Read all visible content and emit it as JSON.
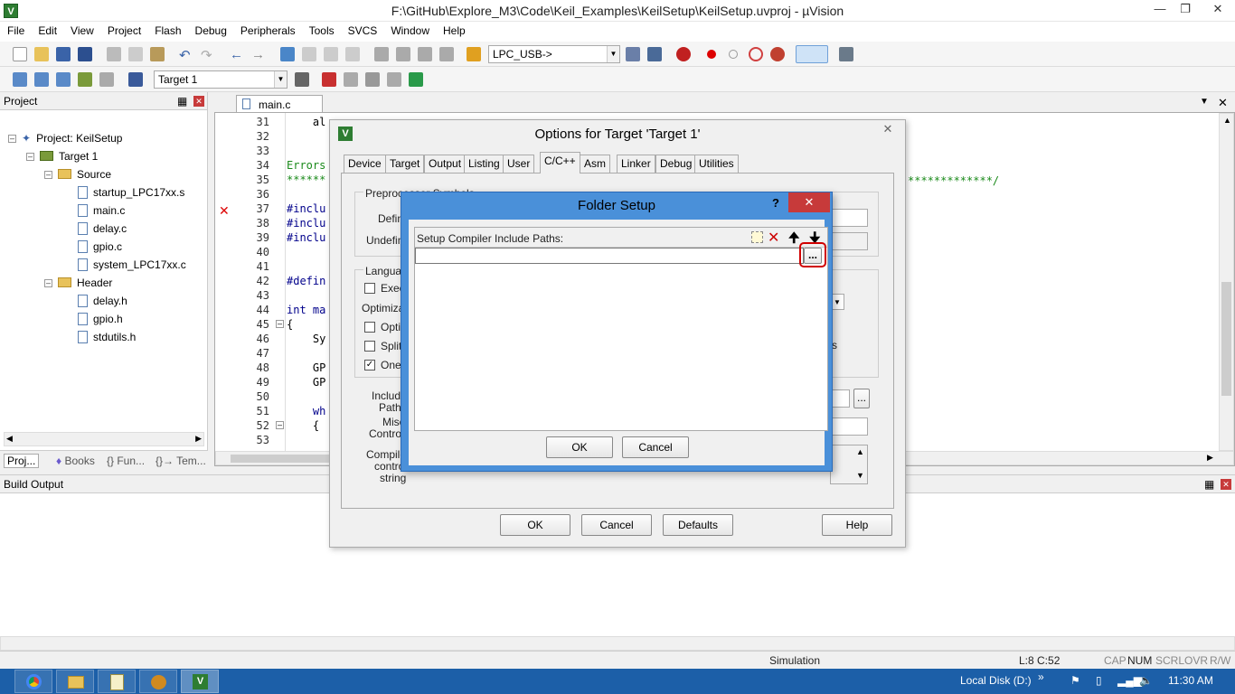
{
  "window": {
    "title": "F:\\GitHub\\Explore_M3\\Code\\Keil_Examples\\KeilSetup\\KeilSetup.uvproj - µVision"
  },
  "menu": [
    "File",
    "Edit",
    "View",
    "Project",
    "Flash",
    "Debug",
    "Peripherals",
    "Tools",
    "SVCS",
    "Window",
    "Help"
  ],
  "toolbar": {
    "device_combo": "LPC_USB->",
    "target_combo": "Target 1"
  },
  "project_panel": {
    "title": "Project",
    "root": "Project: KeilSetup",
    "target": "Target 1",
    "source_group": "Source",
    "source_files": [
      "startup_LPC17xx.s",
      "main.c",
      "delay.c",
      "gpio.c",
      "system_LPC17xx.c"
    ],
    "header_group": "Header",
    "header_files": [
      "delay.h",
      "gpio.h",
      "stdutils.h"
    ],
    "tabs": [
      "Proj...",
      "Books",
      "{} Fun...",
      "{}→ Tem..."
    ]
  },
  "editor": {
    "tab": "main.c",
    "lines": [
      {
        "n": "31",
        "code": "    al"
      },
      {
        "n": "32",
        "code": ""
      },
      {
        "n": "33",
        "code": ""
      },
      {
        "n": "34",
        "code": "Errors"
      },
      {
        "n": "35",
        "code": "******"
      },
      {
        "n": "36",
        "code": ""
      },
      {
        "n": "37",
        "code": "#inclu"
      },
      {
        "n": "38",
        "code": "#inclu"
      },
      {
        "n": "39",
        "code": "#inclu"
      },
      {
        "n": "40",
        "code": ""
      },
      {
        "n": "41",
        "code": ""
      },
      {
        "n": "42",
        "code": "#defin"
      },
      {
        "n": "43",
        "code": ""
      },
      {
        "n": "44",
        "code": "int ma"
      },
      {
        "n": "45",
        "code": "{"
      },
      {
        "n": "46",
        "code": "    Sy"
      },
      {
        "n": "47",
        "code": ""
      },
      {
        "n": "48",
        "code": "    GP"
      },
      {
        "n": "49",
        "code": "    GP"
      },
      {
        "n": "50",
        "code": ""
      },
      {
        "n": "51",
        "code": "    wh"
      },
      {
        "n": "52",
        "code": "    {"
      },
      {
        "n": "53",
        "code": ""
      }
    ],
    "line35_tail": "*************/"
  },
  "build_output": {
    "title": "Build Output"
  },
  "options_dialog": {
    "title": "Options for Target 'Target 1'",
    "tabs": [
      "Device",
      "Target",
      "Output",
      "Listing",
      "User",
      "C/C++",
      "Asm",
      "Linker",
      "Debug",
      "Utilities"
    ],
    "active_tab": "C/C++",
    "group_preprocessor": "Preprocessor Symbols",
    "label_define": "Defin",
    "label_undefine": "Undefin",
    "group_language": "Languag",
    "chk_exec": "Exec",
    "label_optimization": "Optimizati",
    "chk_optim": "Optim",
    "chk_split": "Split",
    "chk_one": "One",
    "label_include": "Include",
    "label_paths": "Paths",
    "label_misc": "Misc",
    "label_controls": "Controls",
    "label_compiler": "Compiler",
    "label_control": "control",
    "label_string": "string",
    "side_s": "s",
    "browse": "...",
    "buttons": {
      "ok": "OK",
      "cancel": "Cancel",
      "defaults": "Defaults",
      "help": "Help"
    }
  },
  "folder_dialog": {
    "title": "Folder Setup",
    "help": "?",
    "label": "Setup Compiler Include Paths:",
    "browse": "...",
    "ok": "OK",
    "cancel": "Cancel"
  },
  "status": {
    "mode": "Simulation",
    "pos": "L:8 C:52",
    "cap": "CAP",
    "num": "NUM",
    "scrl": "SCRL",
    "ovr": "OVR",
    "rw": "R/W"
  },
  "taskbar": {
    "location": "Local Disk (D:)",
    "chevron": "»",
    "time": "11:30 AM"
  },
  "colors": {
    "accent": "#1c5fa8",
    "highlight": "#d00000",
    "dialog_frame": "#4a90d9",
    "close_red": "#c73a3a"
  }
}
